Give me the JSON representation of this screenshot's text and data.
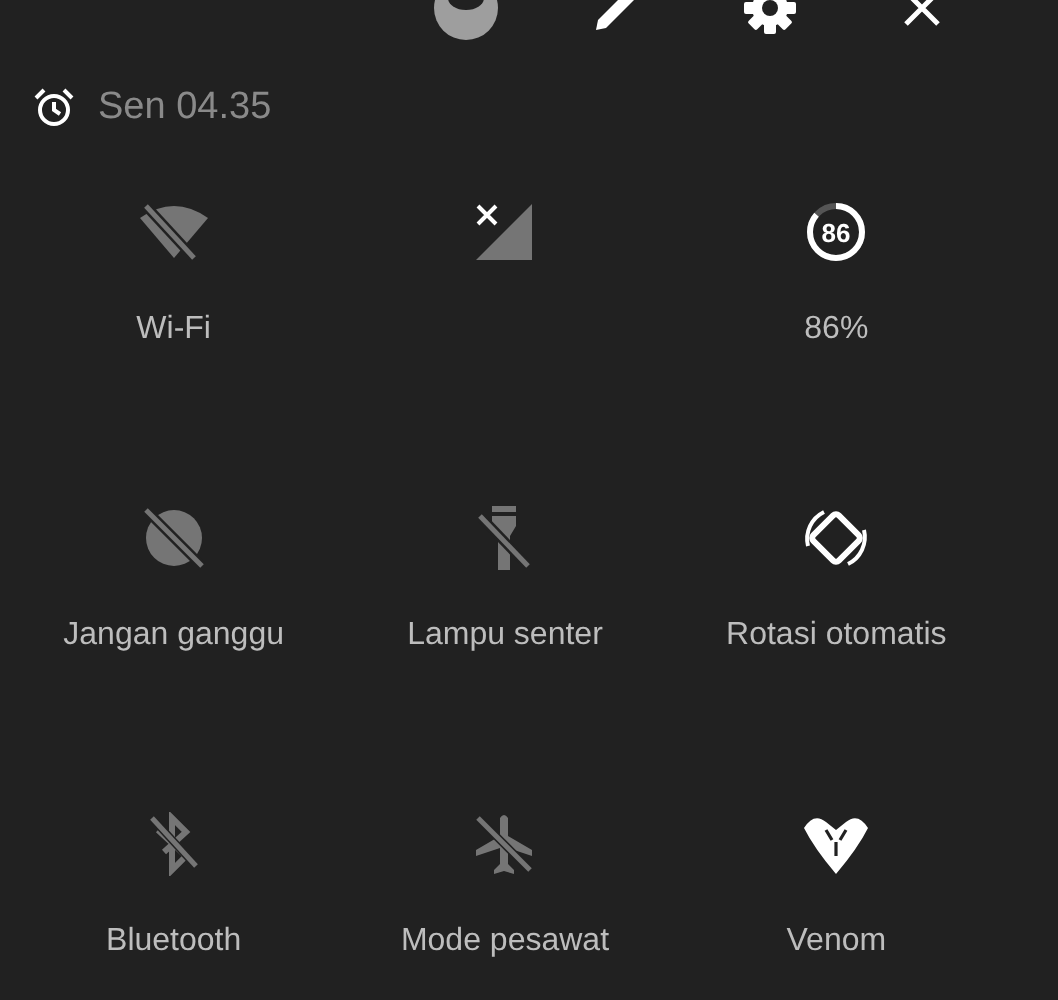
{
  "header": {
    "actions": [
      {
        "kind": "user"
      },
      {
        "kind": "edit"
      },
      {
        "kind": "settings"
      },
      {
        "kind": "close"
      }
    ]
  },
  "alarm": {
    "time": "Sen 04.35"
  },
  "tiles": [
    {
      "kind": "wifi",
      "label": "Wi-Fi",
      "on": false
    },
    {
      "kind": "cellular",
      "on": false
    },
    {
      "kind": "battery",
      "label": "86%",
      "badge": "86",
      "level": 0.86,
      "on": true
    },
    {
      "kind": "dnd",
      "label": "Jangan ganggu",
      "on": false
    },
    {
      "kind": "flashlight",
      "label": "Lampu senter",
      "on": false
    },
    {
      "kind": "rotate",
      "label": "Rotasi otomatis",
      "on": true
    },
    {
      "kind": "bluetooth",
      "label": "Bluetooth",
      "on": false
    },
    {
      "kind": "airplane",
      "label": "Mode pesawat",
      "on": false
    },
    {
      "kind": "venom",
      "label": "Venom",
      "on": true
    }
  ]
}
